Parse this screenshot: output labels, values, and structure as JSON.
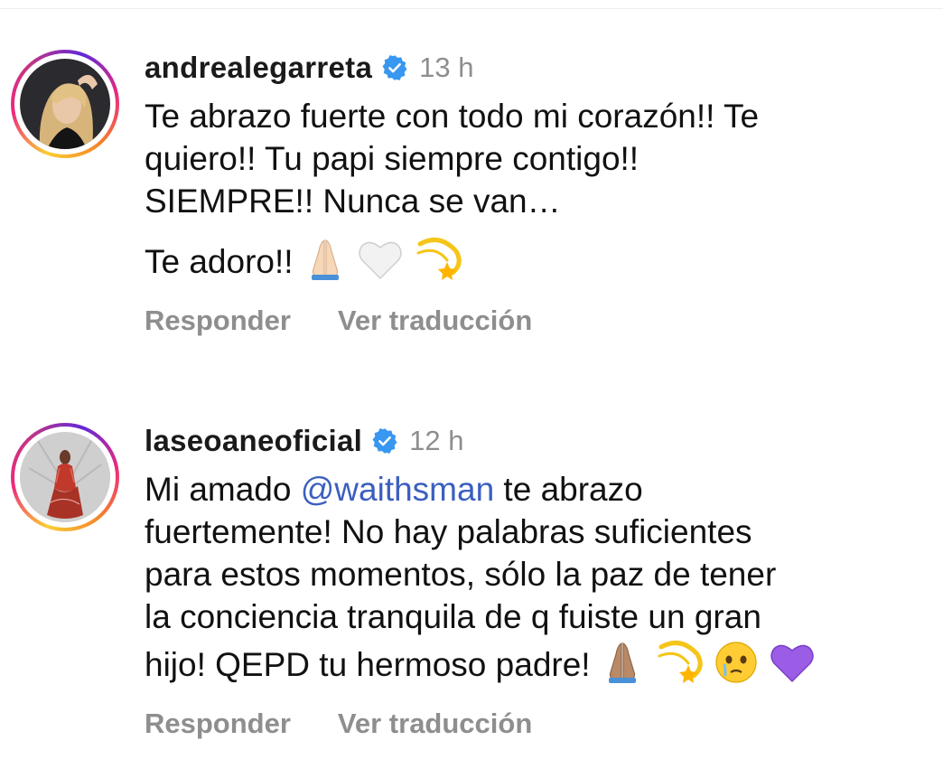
{
  "comments": [
    {
      "username": "andrealegarreta",
      "verified": true,
      "time": "13 h",
      "text_lines": [
        "Te abrazo fuerte con todo mi corazón!! Te",
        "quiero!! Tu papi siempre contigo!!",
        "SIEMPRE!! Nunca se van…"
      ],
      "text2": "Te adoro!!",
      "emojis": [
        "folded-hands-light",
        "white-heart",
        "dizzy"
      ],
      "reply_label": "Responder",
      "translate_label": "Ver traducción"
    },
    {
      "username": "laseoaneoficial",
      "verified": true,
      "time": "12 h",
      "line1_prefix": "Mi amado ",
      "mention": "@waithsman",
      "line1_suffix": " te abrazo",
      "text_lines": [
        "fuertemente! No hay palabras suficientes",
        "para estos momentos, sólo la paz de tener",
        "la conciencia tranquila de q fuiste un gran"
      ],
      "last_line": "hijo! QEPD tu hermoso padre!",
      "emojis": [
        "folded-hands-medium",
        "dizzy",
        "face-holding-back-tears",
        "purple-heart"
      ],
      "reply_label": "Responder",
      "translate_label": "Ver traducción"
    }
  ],
  "colors": {
    "verified_badge": "#3897f0",
    "mention": "#3b5fbf",
    "secondary_text": "#8e8e8e"
  }
}
